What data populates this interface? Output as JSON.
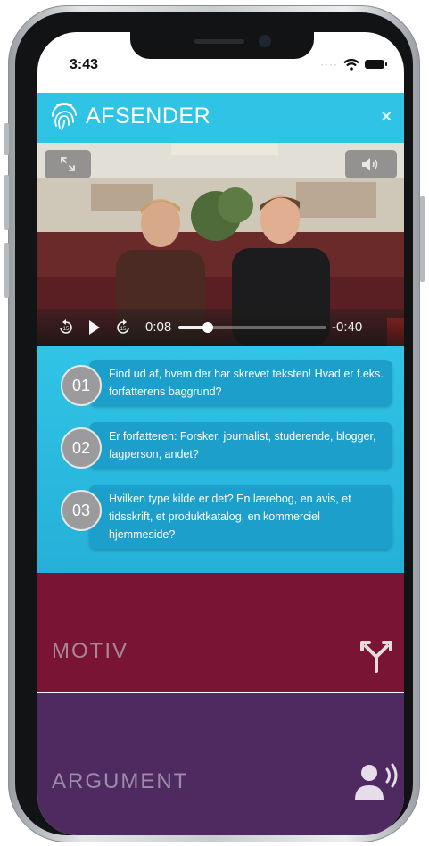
{
  "status_bar": {
    "time": "3:43"
  },
  "header": {
    "title": "AFSENDER",
    "close": "×"
  },
  "video": {
    "elapsed": "0:08",
    "remaining": "-0:40",
    "progress": 0.2,
    "skip_back_label": "15",
    "skip_forward_label": "15"
  },
  "steps": [
    {
      "number": "01",
      "text": "Find ud af, hvem der har skrevet teksten! Hvad er f.eks. forfatterens baggrund?"
    },
    {
      "number": "02",
      "text": "Er forfatteren: Forsker, journalist, studerende, blogger, fagperson, andet?"
    },
    {
      "number": "03",
      "text": "Hvilken type kilde er det? En lærebog, en avis, et tidsskrift, et produktkatalog, en kommerciel hjemmeside?"
    }
  ],
  "sections": {
    "motiv": {
      "title": "MOTIV",
      "icon": "fork-arrows-icon"
    },
    "argument": {
      "title": "ARGUMENT",
      "icon": "speaker-person-icon"
    }
  },
  "colors": {
    "header": "#2fc3e6",
    "motiv": "#7a1434",
    "argument": "#4e2a60"
  }
}
